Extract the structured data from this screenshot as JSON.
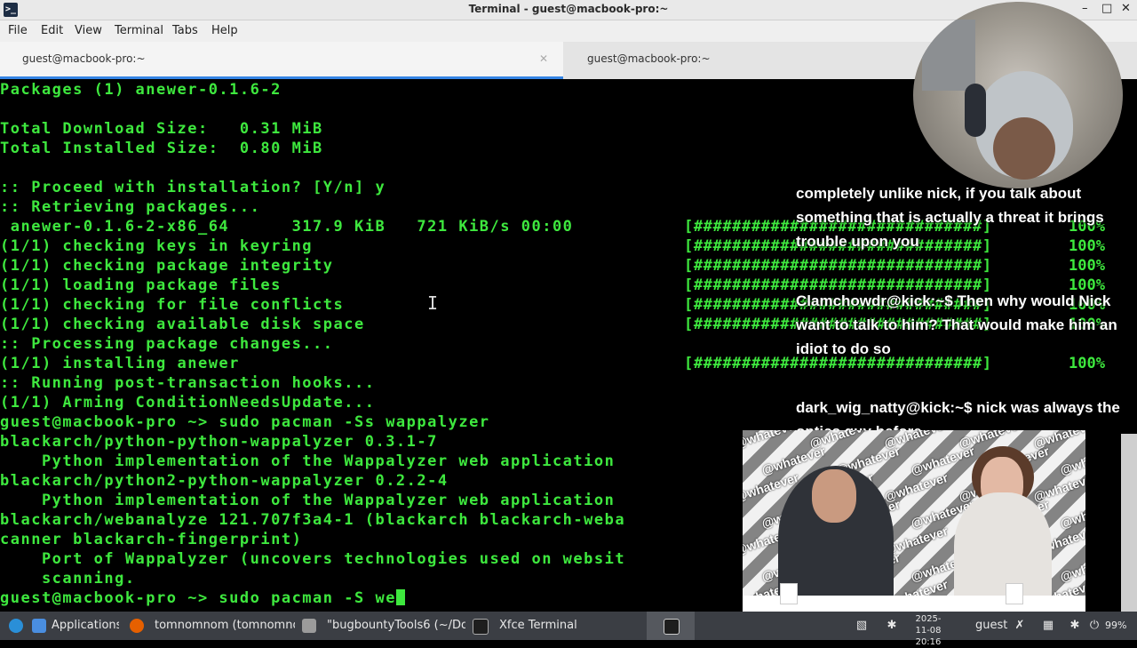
{
  "window": {
    "title": "Terminal - guest@macbook-pro:~"
  },
  "menu": [
    "File",
    "Edit",
    "View",
    "Terminal",
    "Tabs",
    "Help"
  ],
  "tabs": [
    {
      "label": "guest@macbook-pro:~",
      "active": true
    },
    {
      "label": "guest@macbook-pro:~",
      "active": false
    }
  ],
  "terminal": {
    "lines": [
      "Packages (1) anewer-0.1.6-2",
      "",
      "Total Download Size:   0.31 MiB",
      "Total Installed Size:  0.80 MiB",
      "",
      ":: Proceed with installation? [Y/n] y",
      ":: Retrieving packages...",
      " anewer-0.1.6-2-x86_64      317.9 KiB   721 KiB/s 00:00",
      "(1/1) checking keys in keyring",
      "(1/1) checking package integrity",
      "(1/1) loading package files",
      "(1/1) checking for file conflicts",
      "(1/1) checking available disk space",
      ":: Processing package changes...",
      "(1/1) installing anewer",
      ":: Running post-transaction hooks...",
      "(1/1) Arming ConditionNeedsUpdate...",
      "guest@macbook-pro ~> sudo pacman -Ss wappalyzer",
      "blackarch/python-python-wappalyzer 0.3.1-7",
      "    Python implementation of the Wappalyzer web application",
      "blackarch/python2-python-wappalyzer 0.2.2-4",
      "    Python implementation of the Wappalyzer web application",
      "blackarch/webanalyze 121.707f3a4-1 (blackarch blackarch-weba",
      "canner blackarch-fingerprint)",
      "    Port of Wappalyzer (uncovers technologies used on websit",
      "    scanning.",
      "guest@macbook-pro ~> sudo pacman -S we"
    ],
    "progress_bar": "[##############################]",
    "progress_pct": "100%",
    "progress_rows": [
      7,
      8,
      9,
      10,
      11,
      12,
      14
    ]
  },
  "chat": [
    {
      "user": "",
      "text": "completely unlike nick, if you talk about something that is actually a threat it brings trouble upon you"
    },
    {
      "user": "Clamchowdr@kick:~$",
      "text": " Then why would Nick want to talk to him? That would make him an idiot to do so"
    },
    {
      "user": "dark_wig_natty@kick:~$",
      "text": " nick was always the optics guy before"
    }
  ],
  "video": {
    "watermark": "@whatever"
  },
  "taskbar": {
    "items": [
      {
        "label": "Applications",
        "icon": "applications-menu-icon"
      },
      {
        "label": "tomnomnom (tomnomno...",
        "icon": "firefox-icon"
      },
      {
        "label": "\"bugbountyTools6 (~/Do...",
        "icon": "text-editor-icon"
      },
      {
        "label": "Xfce Terminal",
        "icon": "terminal-icon"
      }
    ],
    "clock": {
      "date": "2025-11-08",
      "time": "20:16"
    },
    "user": "guest",
    "battery": "99%"
  },
  "colors": {
    "terminal_fg": "#3ee83e",
    "terminal_bg": "#000000",
    "tab_accent": "#3584e4",
    "taskbar_bg": "#3b3e44"
  }
}
